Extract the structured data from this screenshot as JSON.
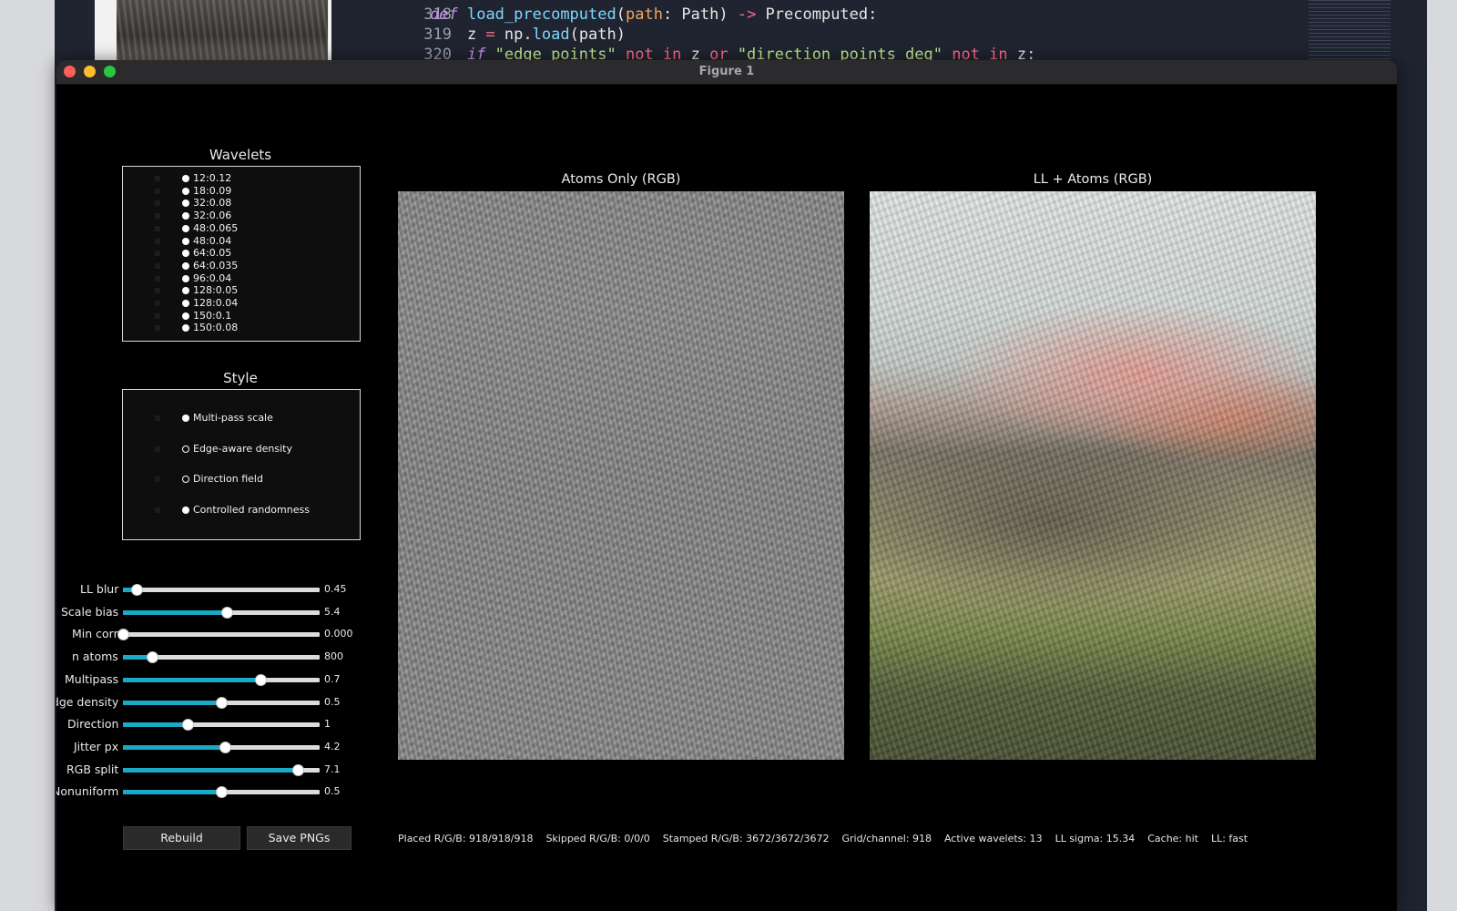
{
  "editor": {
    "lines": [
      {
        "num": "318",
        "parts": [
          {
            "t": "def",
            "c": "kw"
          },
          {
            "t": " ",
            "c": ""
          },
          {
            "t": "load_precomputed",
            "c": "fn"
          },
          {
            "t": "(",
            "c": ""
          },
          {
            "t": "path",
            "c": "pm"
          },
          {
            "t": ": Path) ",
            "c": ""
          },
          {
            "t": "->",
            "c": "op"
          },
          {
            "t": " Precomputed:",
            "c": ""
          }
        ]
      },
      {
        "num": "319",
        "parts": [
          {
            "t": "    z ",
            "c": ""
          },
          {
            "t": "=",
            "c": "op"
          },
          {
            "t": " np.",
            "c": ""
          },
          {
            "t": "load",
            "c": "fn"
          },
          {
            "t": "(path)",
            "c": ""
          }
        ]
      },
      {
        "num": "320",
        "parts": [
          {
            "t": "    if ",
            "c": "kw"
          },
          {
            "t": "\"edge_points\"",
            "c": "str"
          },
          {
            "t": " not in ",
            "c": "op"
          },
          {
            "t": "z ",
            "c": ""
          },
          {
            "t": "or ",
            "c": "op"
          },
          {
            "t": "\"direction_points_deg\"",
            "c": "str"
          },
          {
            "t": " not in ",
            "c": "op"
          },
          {
            "t": "z:",
            "c": ""
          }
        ]
      }
    ]
  },
  "window": {
    "title": "Figure 1"
  },
  "wavelets": {
    "title": "Wavelets",
    "items": [
      {
        "label": "12:0.12",
        "checked": true
      },
      {
        "label": "18:0.09",
        "checked": true
      },
      {
        "label": "32:0.08",
        "checked": true
      },
      {
        "label": "32:0.06",
        "checked": true
      },
      {
        "label": "48:0.065",
        "checked": true
      },
      {
        "label": "48:0.04",
        "checked": true
      },
      {
        "label": "64:0.05",
        "checked": true
      },
      {
        "label": "64:0.035",
        "checked": true
      },
      {
        "label": "96:0.04",
        "checked": true
      },
      {
        "label": "128:0.05",
        "checked": true
      },
      {
        "label": "128:0.04",
        "checked": true
      },
      {
        "label": "150:0.1",
        "checked": true
      },
      {
        "label": "150:0.08",
        "checked": true
      }
    ]
  },
  "style": {
    "title": "Style",
    "items": [
      {
        "label": "Multi-pass scale",
        "checked": true
      },
      {
        "label": "Edge-aware density",
        "checked": false
      },
      {
        "label": "Direction field",
        "checked": false
      },
      {
        "label": "Controlled randomness",
        "checked": true
      }
    ]
  },
  "sliders": [
    {
      "label": "LL blur",
      "value": "0.45",
      "fraction": 0.07,
      "clipped": false
    },
    {
      "label": "Scale bias",
      "value": "5.4",
      "fraction": 0.53,
      "clipped": true
    },
    {
      "label": "Min corr",
      "value": "0.000",
      "fraction": 0.0,
      "clipped": true
    },
    {
      "label": "n atoms",
      "value": "800",
      "fraction": 0.15,
      "clipped": false
    },
    {
      "label": "Multipass",
      "value": "0.7",
      "fraction": 0.7,
      "clipped": true
    },
    {
      "label": "Edge density",
      "value": "0.5",
      "fraction": 0.5,
      "clipped": true
    },
    {
      "label": "Direction",
      "value": "1",
      "fraction": 0.33,
      "clipped": false
    },
    {
      "label": "Jitter px",
      "value": "4.2",
      "fraction": 0.52,
      "clipped": false
    },
    {
      "label": "RGB split",
      "value": "7.1",
      "fraction": 0.89,
      "clipped": false
    },
    {
      "label": "Nonuniform",
      "value": "0.5",
      "fraction": 0.5,
      "clipped": true
    }
  ],
  "buttons": {
    "rebuild": "Rebuild",
    "save": "Save PNGs"
  },
  "axes": {
    "left_title": "Atoms Only (RGB)",
    "right_title": "LL + Atoms (RGB)"
  },
  "status": {
    "text": "Placed R/G/B: 918/918/918    Skipped R/G/B: 0/0/0    Stamped R/G/B: 3672/3672/3672    Grid/channel: 918    Active wavelets: 13    LL sigma: 15.34    Cache: hit    LL: fast"
  },
  "colors": {
    "slider_fill": "#1aa9c6",
    "background": "#000000"
  }
}
